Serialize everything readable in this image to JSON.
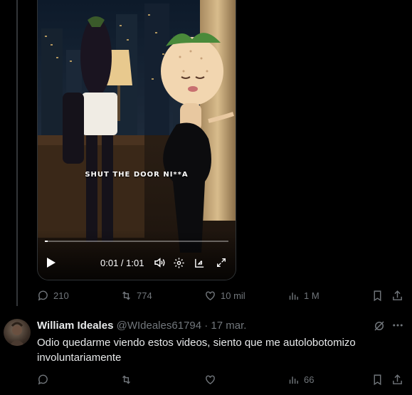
{
  "video": {
    "caption": "SHUT THE DOOR NI**A",
    "time": "0:01 / 1:01",
    "progress": 0.016
  },
  "tweet_actions": {
    "replies": "210",
    "retweets": "774",
    "likes": "10 mil",
    "views": "1 M"
  },
  "reply": {
    "name": "William Ideales",
    "handle": "@WIdeales61794",
    "separator": "·",
    "date": "17 mar.",
    "text": "Odio quedarme viendo estos videos, siento que me autolobotomizo involuntariamente",
    "actions": {
      "replies": "",
      "retweets": "",
      "likes": "",
      "views": "66"
    }
  },
  "colors": {
    "background": "#000000",
    "muted": "#71767b",
    "text": "#e7e9ea",
    "border": "#2f3336"
  }
}
